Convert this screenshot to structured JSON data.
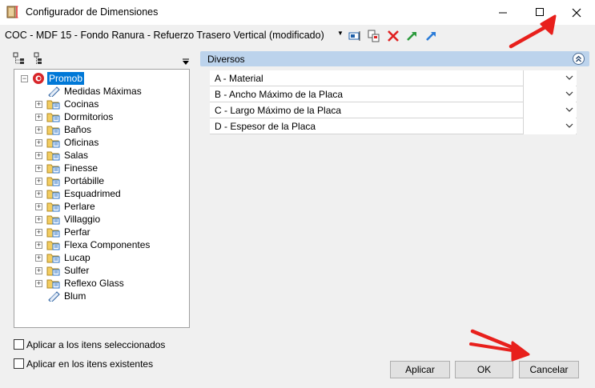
{
  "window": {
    "title": "Configurador de Dimensiones"
  },
  "toolbar": {
    "combo_value": "COC - MDF 15 - Fondo Ranura - Refuerzo Trasero Vertical (modificado)"
  },
  "tree": {
    "root": "Promob",
    "items": [
      "Medidas Máximas",
      "Cocinas",
      "Dormitorios",
      "Baños",
      "Oficinas",
      "Salas",
      "Finesse",
      "Portábille",
      "Esquadrimed",
      "Perlare",
      "Villaggio",
      "Perfar",
      "Flexa Componentes",
      "Lucap",
      "Sulfer",
      "Reflexo Glass",
      "Blum"
    ]
  },
  "panel": {
    "title": "Diversos",
    "properties": [
      {
        "label": "A - Material",
        "value": ""
      },
      {
        "label": "B -  Ancho Máximo de la Placa",
        "value": ""
      },
      {
        "label": "C - Largo Máximo de la Placa",
        "value": ""
      },
      {
        "label": "D - Espesor de la Placa",
        "value": ""
      }
    ]
  },
  "options": {
    "apply_selected": "Aplicar a los itens seleccionados",
    "apply_existing": "Aplicar en los itens existentes"
  },
  "buttons": {
    "apply": "Aplicar",
    "ok": "OK",
    "cancel": "Cancelar"
  },
  "colors": {
    "panel_header": "#bcd3ec",
    "annotation_arrow": "#e8201c",
    "tree_root_highlight": "#0078d7"
  }
}
